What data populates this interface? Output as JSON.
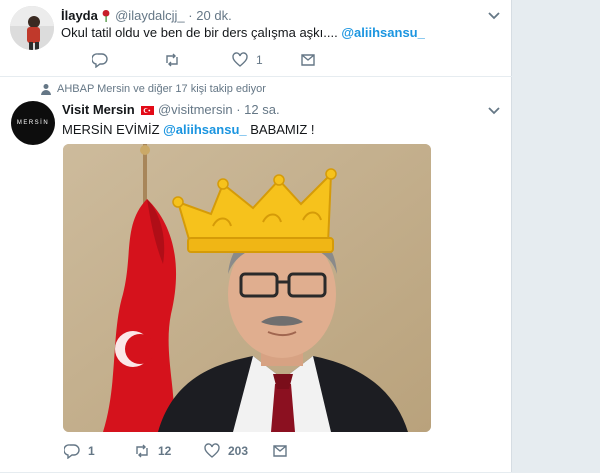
{
  "tweets": [
    {
      "name": "İlayda",
      "handle": "@ilaydalcjj_",
      "dot": "·",
      "time": "20 dk.",
      "text": "Okul tatil oldu ve ben de bir ders çalışma aşkı.... ",
      "mention": "@aliihsansu_",
      "actions": {
        "reply": "",
        "retweet": "",
        "like": "1",
        "dm": ""
      }
    },
    {
      "social_context": "AHBAP Mersin ve diğer 17 kişi takip ediyor",
      "name": "Visit Mersin",
      "handle": "@visitmersin",
      "dot": "·",
      "time": "12 sa.",
      "avatar_text": "MERSİN",
      "text_before": "MERSİN EVİMİZ ",
      "mention": "@aliihsansu_",
      "text_after": " BABAMIZ !",
      "actions": {
        "reply": "1",
        "retweet": "12",
        "like": "203",
        "dm": ""
      }
    }
  ],
  "colors": {
    "accent": "#1b95e0",
    "muted": "#657786",
    "crown": "#f6c21c",
    "flag": "#e30a17"
  },
  "icons": [
    "rose-emoji-icon",
    "turkey-flag-icon",
    "reply-icon",
    "retweet-icon",
    "like-icon",
    "direct-message-icon",
    "chevron-down-icon",
    "person-icon"
  ]
}
